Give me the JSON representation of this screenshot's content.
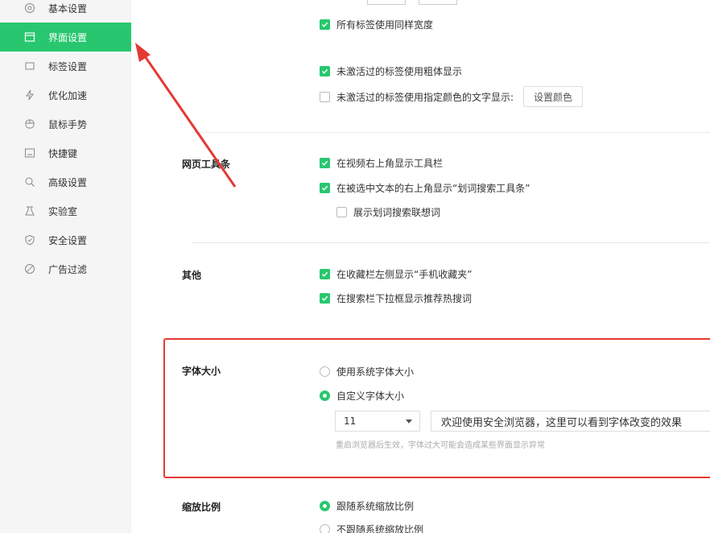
{
  "sidebar": {
    "items": [
      {
        "label": "基本设置",
        "icon": "settings-icon"
      },
      {
        "label": "界面设置",
        "icon": "window-icon",
        "active": true
      },
      {
        "label": "标签设置",
        "icon": "tab-icon"
      },
      {
        "label": "优化加速",
        "icon": "bolt-icon"
      },
      {
        "label": "鼠标手势",
        "icon": "mouse-icon"
      },
      {
        "label": "快捷键",
        "icon": "keyboard-icon"
      },
      {
        "label": "高级设置",
        "icon": "advanced-icon"
      },
      {
        "label": "实验室",
        "icon": "flask-icon"
      },
      {
        "label": "安全设置",
        "icon": "shield-icon"
      },
      {
        "label": "广告过滤",
        "icon": "block-icon"
      }
    ]
  },
  "tabs_section": {
    "same_width": "所有标签使用同样宽度",
    "bold_inactive": "未激活过的标签使用粗体显示",
    "color_inactive": "未激活过的标签使用指定颜色的文字显示:",
    "set_color_button": "设置颜色"
  },
  "toolbar_section": {
    "title": "网页工具条",
    "video_toolbar": "在视频右上角显示工具栏",
    "selection_toolbar": "在被选中文本的右上角显示“划词搜索工具条”",
    "show_suggestions": "展示划词搜索联想词"
  },
  "other_section": {
    "title": "其他",
    "mobile_favorites": "在收藏栏左侧显示“手机收藏夹”",
    "hot_search": "在搜索栏下拉框显示推荐热搜词"
  },
  "font_section": {
    "title": "字体大小",
    "system_font": "使用系统字体大小",
    "custom_font": "自定义字体大小",
    "font_size_value": "11",
    "preview_text": "欢迎使用安全浏览器，这里可以看到字体改变的效果",
    "hint": "重启浏览器后生效，字体过大可能会造成某些界面显示异常"
  },
  "zoom_section": {
    "title": "缩放比例",
    "follow_system": "跟随系统缩放比例",
    "not_follow_system": "不跟随系统缩放比例"
  },
  "colors": {
    "accent": "#28c76f",
    "annotation": "#e53935"
  }
}
